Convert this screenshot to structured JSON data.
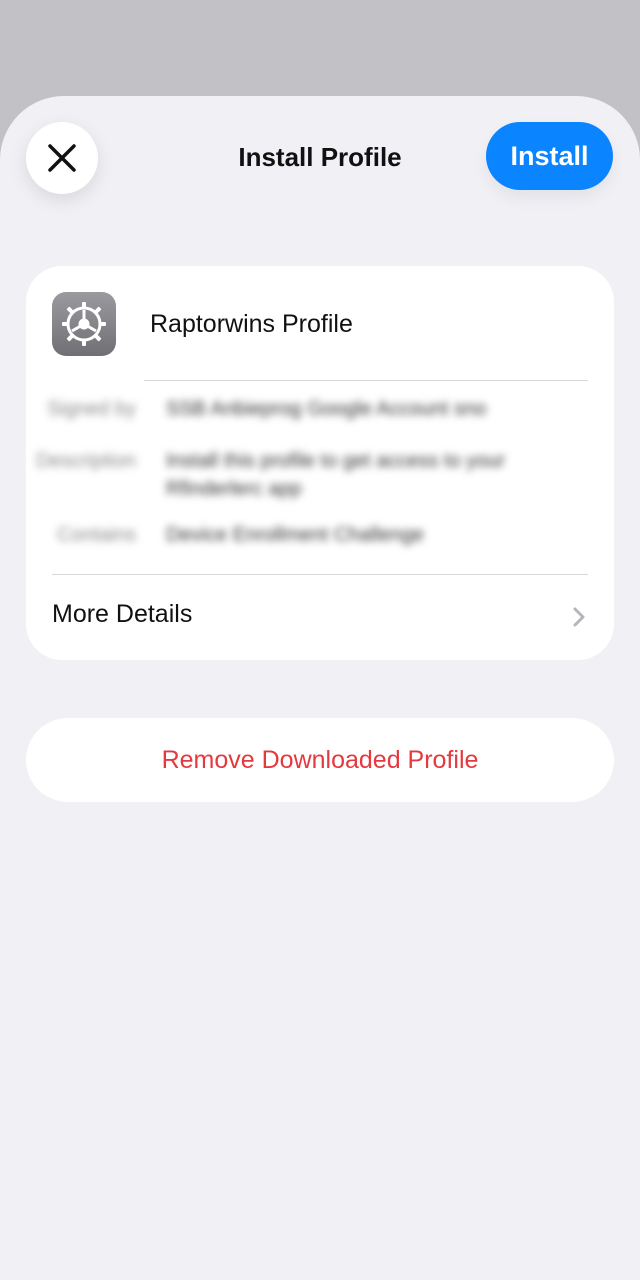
{
  "header": {
    "title": "Install Profile",
    "install_label": "Install",
    "close_icon": "close-icon"
  },
  "profile": {
    "name": "Raptorwins Profile",
    "icon": "settings-gear-icon",
    "details": [
      {
        "label": "Signed by",
        "value": "SSB Anbieprog Google Account sno"
      },
      {
        "label": "Description",
        "value": "Install this profile to get access to your",
        "value2": "Rfinderlerc app"
      },
      {
        "label": "Contains",
        "value": "Device Enrollment Challenge"
      }
    ],
    "more_details_label": "More Details"
  },
  "remove_label": "Remove Downloaded Profile",
  "colors": {
    "accent": "#0a84ff",
    "destructive": "#e5393f",
    "sheet_bg": "#f1f0f5",
    "backdrop": "#c2c1c6"
  }
}
